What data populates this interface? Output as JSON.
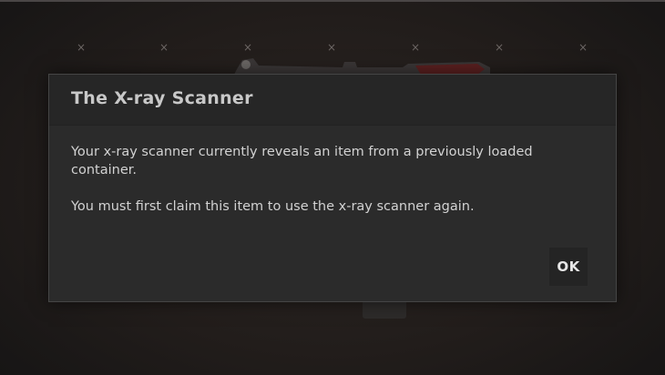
{
  "background": {
    "grid_marks": [
      "×",
      "×",
      "×",
      "×",
      "×",
      "×",
      "×"
    ]
  },
  "modal": {
    "title": "The X-ray Scanner",
    "paragraphs": [
      "Your x-ray scanner currently reveals an item from a previously loaded container.",
      "You must first claim this item to use the x-ray scanner again."
    ],
    "ok_label": "OK"
  },
  "colors": {
    "modal_bg": "#2b2b2b",
    "header_bg": "#262626",
    "title_text": "#c8c8c8",
    "body_text": "#d2d2d2",
    "button_bg": "#242424"
  }
}
